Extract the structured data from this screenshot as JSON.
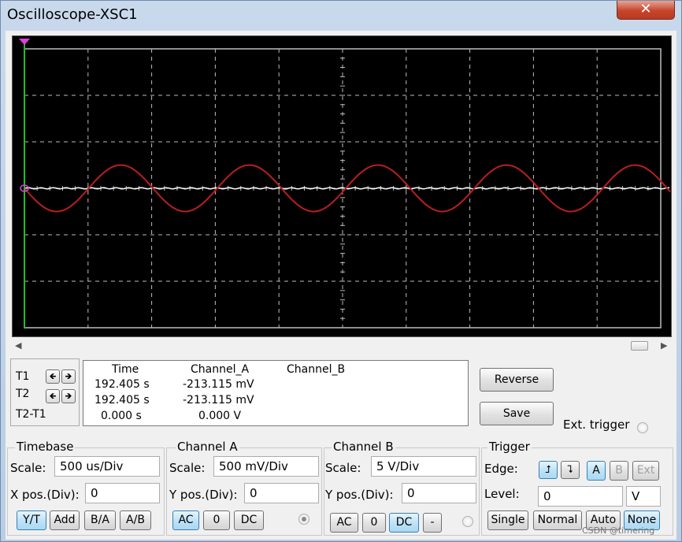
{
  "window": {
    "title": "Oscilloscope-XSC1",
    "close_glyph": "✕"
  },
  "scroll": {
    "left_glyph": "◀",
    "right_glyph": "▶"
  },
  "cursors": {
    "t1_label": "T1",
    "t2_label": "T2",
    "diff_label": "T2-T1",
    "left_glyph": "🡸",
    "right_glyph": "🡺"
  },
  "readout": {
    "headers": {
      "time": "Time",
      "channel_a": "Channel_A",
      "channel_b": "Channel_B"
    },
    "rows": [
      {
        "time": "192.405 s",
        "channel_a": "-213.115 mV",
        "channel_b": ""
      },
      {
        "time": "192.405 s",
        "channel_a": "-213.115 mV",
        "channel_b": ""
      },
      {
        "time": "0.000 s",
        "channel_a": "0.000 V",
        "channel_b": ""
      }
    ]
  },
  "actions": {
    "reverse": "Reverse",
    "save": "Save",
    "ext_trigger": "Ext. trigger"
  },
  "timebase": {
    "title": "Timebase",
    "scale_label": "Scale:",
    "scale_value": "500 us/Div",
    "xpos_label": "X pos.(Div):",
    "xpos_value": "0",
    "buttons": [
      "Y/T",
      "Add",
      "B/A",
      "A/B"
    ],
    "selected": "Y/T"
  },
  "channel_a": {
    "title": "Channel A",
    "scale_label": "Scale:",
    "scale_value": "500 mV/Div",
    "ypos_label": "Y pos.(Div):",
    "ypos_value": "0",
    "coupling": [
      "AC",
      "0",
      "DC"
    ],
    "selected": "AC"
  },
  "channel_b": {
    "title": "Channel B",
    "scale_label": "Scale:",
    "scale_value": "5  V/Div",
    "ypos_label": "Y pos.(Div):",
    "ypos_value": "0",
    "coupling": [
      "AC",
      "0",
      "DC",
      "-"
    ],
    "selected": "DC"
  },
  "trigger": {
    "title": "Trigger",
    "edge_label": "Edge:",
    "level_label": "Level:",
    "level_value": "0",
    "level_unit": "V",
    "edge_rising_glyph": "⮥",
    "edge_falling_glyph": "⮧",
    "sources": [
      "A",
      "B",
      "Ext"
    ],
    "selected_source": "A",
    "modes": [
      "Single",
      "Normal",
      "Auto",
      "None"
    ],
    "selected_mode": "None"
  },
  "watermark": "CSDN @timering",
  "colors": {
    "screen_bg": "#000000",
    "grid": "#bdbdbd",
    "channel_a_trace": "#b81f1f",
    "channel_b_trace": "#ffffff",
    "cursor_t1": "#1fbf1f",
    "cursor_marker": "#e040e0"
  },
  "waveform": {
    "channel_a": {
      "cycles_on_screen": 4.95,
      "amplitude_div": 0.5,
      "offset_div": 0.0
    },
    "channel_b": {
      "level_div": 0.0
    }
  }
}
